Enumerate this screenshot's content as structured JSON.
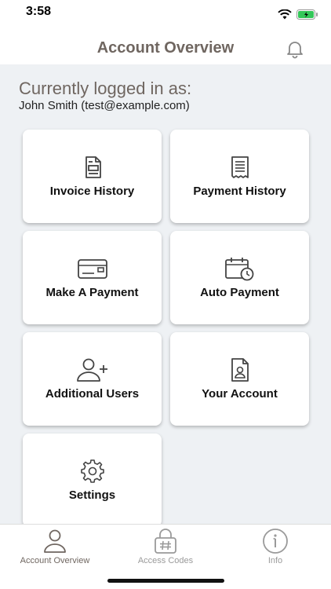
{
  "status_bar": {
    "time": "3:58"
  },
  "header": {
    "title": "Account Overview"
  },
  "session": {
    "heading": "Currently logged in as:",
    "user": "John Smith (test@example.com)"
  },
  "cards": [
    {
      "label": "Invoice History",
      "icon": "invoice-icon"
    },
    {
      "label": "Payment History",
      "icon": "receipt-icon"
    },
    {
      "label": "Make A Payment",
      "icon": "credit-card-icon"
    },
    {
      "label": "Auto Payment",
      "icon": "calendar-clock-icon"
    },
    {
      "label": "Additional Users",
      "icon": "add-user-icon"
    },
    {
      "label": "Your Account",
      "icon": "account-file-icon"
    },
    {
      "label": "Settings",
      "icon": "gear-icon"
    }
  ],
  "tabs": [
    {
      "label": "Account Overview",
      "icon": "user-icon",
      "active": true
    },
    {
      "label": "Access Codes",
      "icon": "lock-hash-icon",
      "active": false
    },
    {
      "label": "Info",
      "icon": "info-icon",
      "active": false
    }
  ],
  "colors": {
    "accent": "#6f6660",
    "background": "#eef1f4",
    "battery": "#34c759"
  }
}
